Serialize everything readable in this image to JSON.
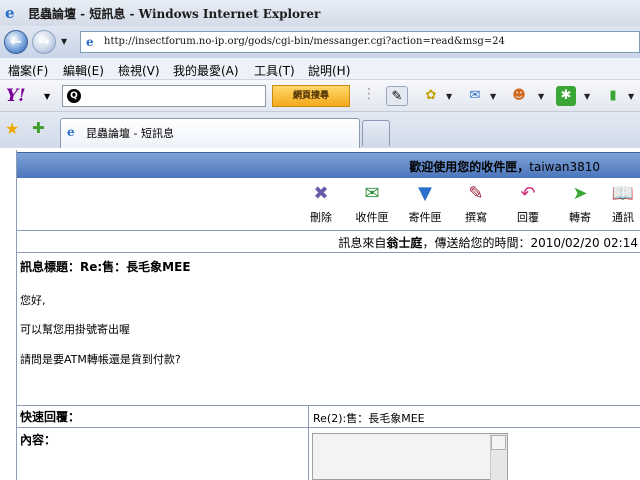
{
  "window": {
    "title": "昆蟲論壇 - 短訊息 - Windows Internet Explorer"
  },
  "address_bar": {
    "url": "http://insectforum.no-ip.org/gods/cgi-bin/messanger.cgi?action=read&msg=24"
  },
  "menu": {
    "items": [
      "檔案(F)",
      "編輯(E)",
      "檢視(V)",
      "我的最愛(A)",
      "工具(T)",
      "說明(H)"
    ]
  },
  "yahoo_toolbar": {
    "logo": "Y!",
    "search_value": "",
    "search_button": "網頁搜尋"
  },
  "tabs": {
    "active_label": "昆蟲論壇 - 短訊息"
  },
  "page": {
    "welcome_prefix": "歡迎使用您的收件匣，",
    "username": "taiwan3810",
    "actions": [
      {
        "label": "刪除",
        "icon": "delete-icon"
      },
      {
        "label": "收件匣",
        "icon": "inbox-icon"
      },
      {
        "label": "寄件匣",
        "icon": "outbox-icon"
      },
      {
        "label": "撰寫",
        "icon": "compose-icon"
      },
      {
        "label": "回覆",
        "icon": "reply-icon"
      },
      {
        "label": "轉寄",
        "icon": "forward-icon"
      },
      {
        "label": "通訊",
        "icon": "address-book-icon"
      }
    ],
    "meta_prefix": "訊息來自",
    "sender": "翁士庭",
    "meta_suffix": "，傳送給您的時間：2010/02/20 02:14",
    "subject": "訊息標題：Re:售：長毛象MEE",
    "body_lines": [
      "您好,",
      "可以幫您用掛號寄出喔",
      "請問是要ATM轉帳還是貨到付款?"
    ],
    "quick_reply_label": "快速回覆：",
    "reply_subject": "Re(2):售：長毛象MEE",
    "content_label": "內容："
  }
}
